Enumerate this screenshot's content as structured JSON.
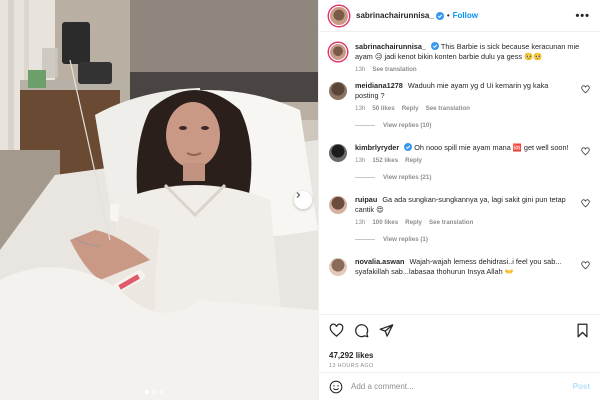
{
  "post": {
    "username": "sabrinachairunnisa_",
    "follow_label": "Follow",
    "separator": "•",
    "caption": {
      "username": "sabrinachairunnisa_",
      "text": "This Barbie is sick because keracunan mie ayam 😥 jadi kenot bikin konten barbie dulu ya gess 🥺🥺",
      "age": "13h",
      "see_translation": "See translation"
    },
    "likes": "47,292 likes",
    "time": "13 HOURS AGO",
    "carousel": {
      "slides": 3,
      "active": 0
    }
  },
  "comments": [
    {
      "username": "meidiana1278",
      "verified": false,
      "text": "Waduuh mie ayam yg d Ui kemarin yg kaka posting ?",
      "age": "13h",
      "likes": "50 likes",
      "reply": "Reply",
      "translate": "See translation",
      "view_replies": "View replies (10)"
    },
    {
      "username": "kimbrlyryder",
      "verified": true,
      "text": "Oh nooo spill mie ayam mana 🆘 get well soon!",
      "age": "13h",
      "likes": "152 likes",
      "reply": "Reply",
      "translate": "",
      "view_replies": "View replies (21)"
    },
    {
      "username": "ruipau",
      "verified": false,
      "text": "Ga ada sungkan-sungkannya ya, lagi sakit gini pun tetap cantik 😍",
      "age": "13h",
      "likes": "100 likes",
      "reply": "Reply",
      "translate": "See translation",
      "view_replies": "View replies (1)"
    },
    {
      "username": "novalia.aswan",
      "verified": false,
      "text": "Wajah-wajah lemess dehidrasi..i feel you sab... syafakillah sab...labasaa thohurun Insya Allah 👐",
      "age": "",
      "likes": "",
      "reply": "",
      "translate": "",
      "view_replies": ""
    }
  ],
  "comment_box": {
    "placeholder": "Add a comment...",
    "post_label": "Post"
  },
  "icons": [
    "more-icon",
    "verified-icon",
    "heart-icon",
    "comment-icon",
    "share-icon",
    "bookmark-icon",
    "emoji-icon",
    "chevron-right-icon"
  ],
  "colors": {
    "accent": "#0095f6",
    "muted": "#8e8e8e",
    "verified": "#3897f0",
    "post_disabled": "#b2dffc"
  }
}
